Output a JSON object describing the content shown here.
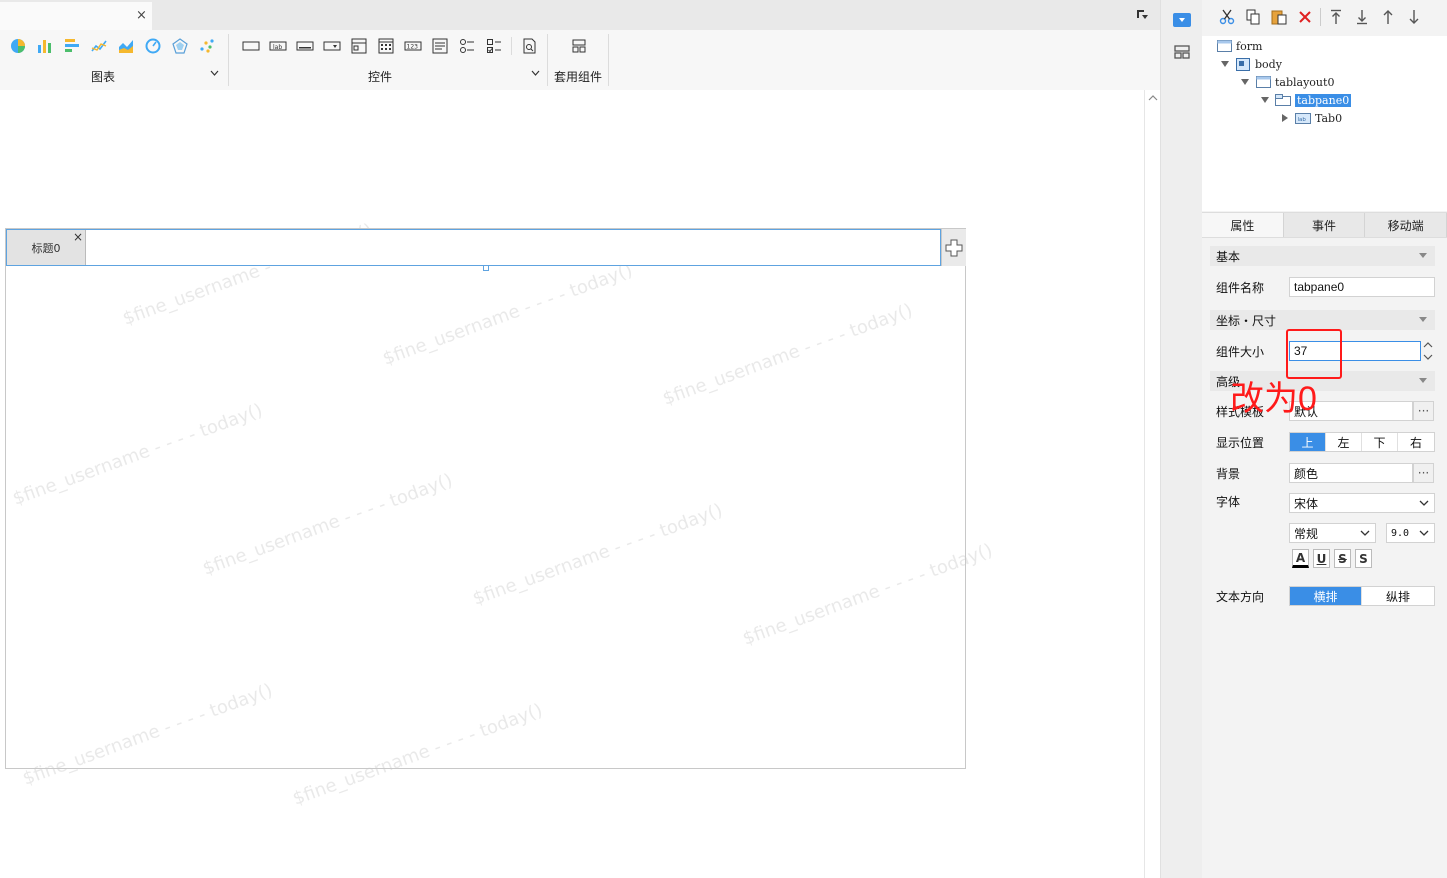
{
  "toolbar": {
    "groups": [
      {
        "label": "图表"
      },
      {
        "label": "控件"
      },
      {
        "label": "套用组件"
      }
    ]
  },
  "canvas": {
    "watermark_text": "$fine_username - - - - today()",
    "tab": {
      "title": "标题0",
      "close": "×"
    }
  },
  "doc_tab": {
    "close": "×"
  },
  "tree": {
    "nodes": [
      {
        "label": "form"
      },
      {
        "label": "body"
      },
      {
        "label": "tablayout0"
      },
      {
        "label": "tabpane0"
      },
      {
        "label": "Tab0"
      }
    ]
  },
  "prop_tabs": [
    "属性",
    "事件",
    "移动端"
  ],
  "props": {
    "basic_header": "基本",
    "component_name_label": "组件名称",
    "component_name_value": "tabpane0",
    "coords_header": "坐标・尺寸",
    "size_label": "组件大小",
    "size_value": "37",
    "advanced_header": "高级",
    "style_label": "样式模板",
    "style_value": "默认",
    "position_label": "显示位置",
    "position_options": [
      "上",
      "左",
      "下",
      "右"
    ],
    "position_selected": "上",
    "background_label": "背景",
    "background_value": "颜色",
    "font_label": "字体",
    "font_family": "宋体",
    "font_style": "常规",
    "font_size": "9.0",
    "format_buttons": [
      "A",
      "U",
      "S",
      "S"
    ],
    "text_dir_label": "文本方向",
    "text_dir_options": [
      "横排",
      "纵排"
    ],
    "text_dir_selected": "横排"
  },
  "annotation": {
    "text": "改为0"
  },
  "colors": {
    "accent": "#3a8ee6",
    "annotation": "#ff1a1a"
  }
}
